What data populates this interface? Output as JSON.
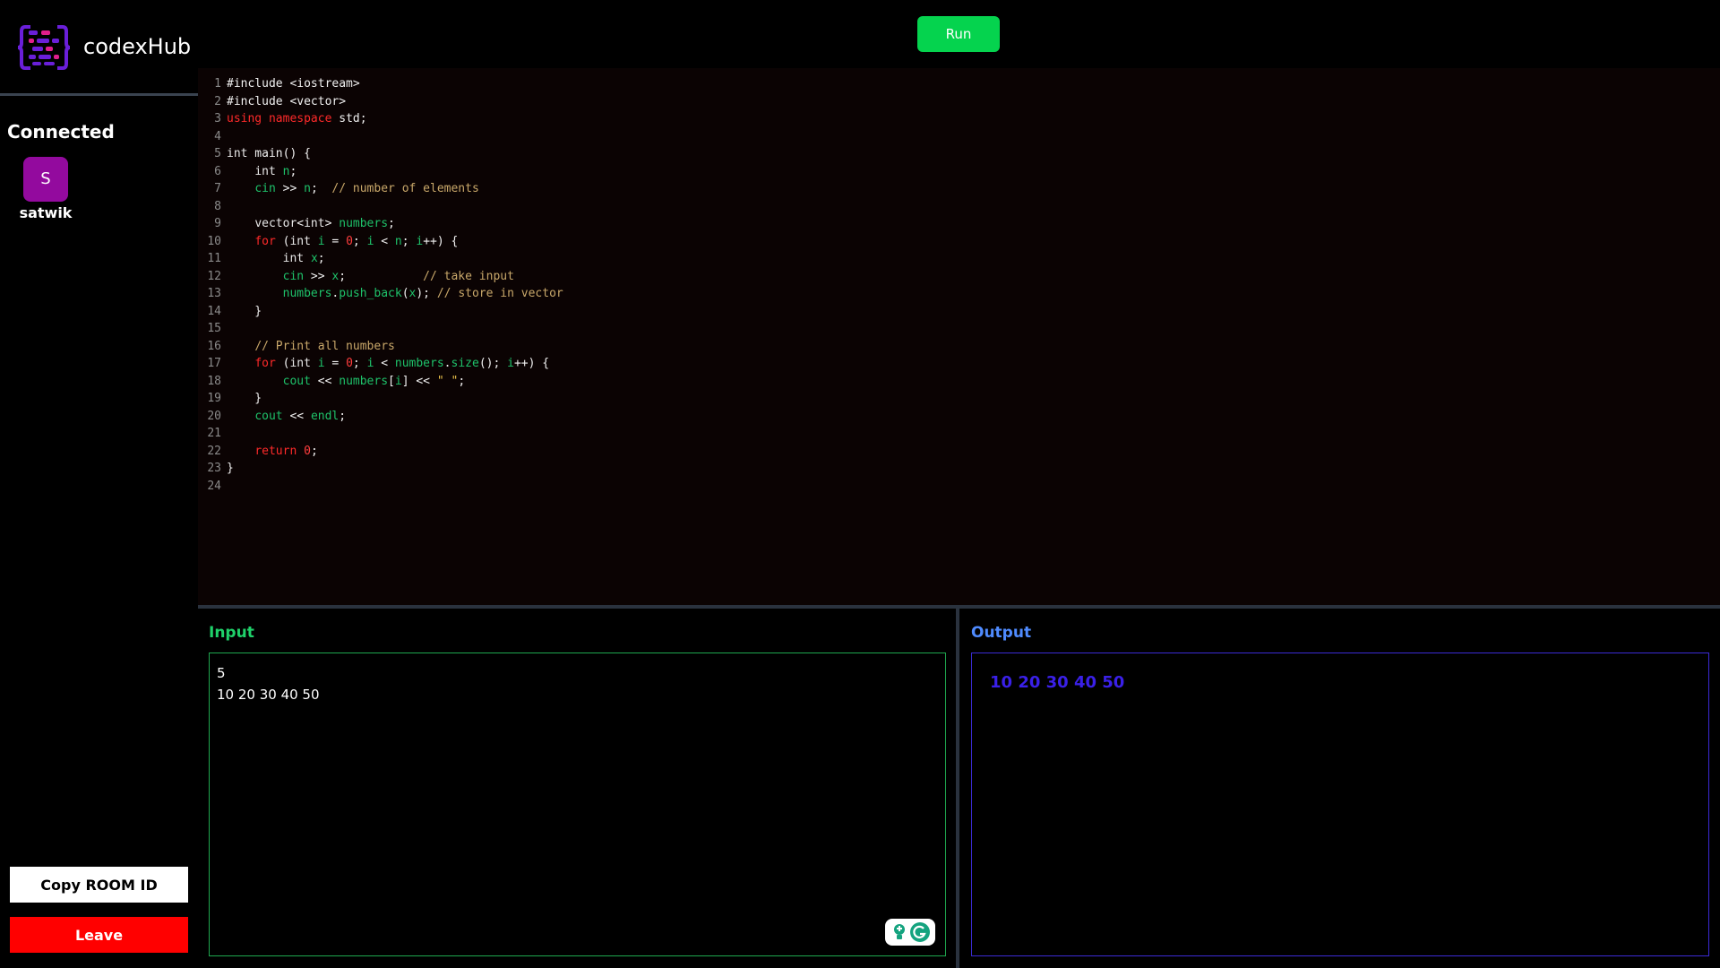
{
  "sidebar": {
    "brand": "codexHub",
    "connected_title": "Connected",
    "clients": [
      {
        "initial": "S",
        "name": "satwik",
        "color": "#930a9e"
      }
    ],
    "copy_room_label": "Copy ROOM ID",
    "leave_label": "Leave"
  },
  "toolbar": {
    "run_label": "Run"
  },
  "editor": {
    "line_numbers": [
      "1",
      "2",
      "3",
      "4",
      "5",
      "6",
      "7",
      "8",
      "9",
      "10",
      "11",
      "12",
      "13",
      "14",
      "15",
      "16",
      "17",
      "18",
      "19",
      "20",
      "21",
      "22",
      "23",
      "24"
    ],
    "lines": [
      "#include <iostream>",
      "#include <vector>",
      "using namespace std;",
      "",
      "int main() {",
      "    int n;",
      "    cin >> n;  // number of elements",
      "",
      "    vector<int> numbers;",
      "    for (int i = 0; i < n; i++) {",
      "        int x;",
      "        cin >> x;           // take input",
      "        numbers.push_back(x); // store in vector",
      "    }",
      "",
      "    // Print all numbers",
      "    for (int i = 0; i < numbers.size(); i++) {",
      "        cout << numbers[i] << \" \";",
      "    }",
      "    cout << endl;",
      "",
      "    return 0;",
      "}",
      ""
    ]
  },
  "io": {
    "input_title": "Input",
    "input_value": "5\n10 20 30 40 50",
    "output_title": "Output",
    "output_value": "10 20 30 40 50"
  },
  "colors": {
    "run": "#05d34e",
    "leave": "#ff0000",
    "input_accent": "#1fd16a",
    "output_accent": "#4f8bff"
  }
}
